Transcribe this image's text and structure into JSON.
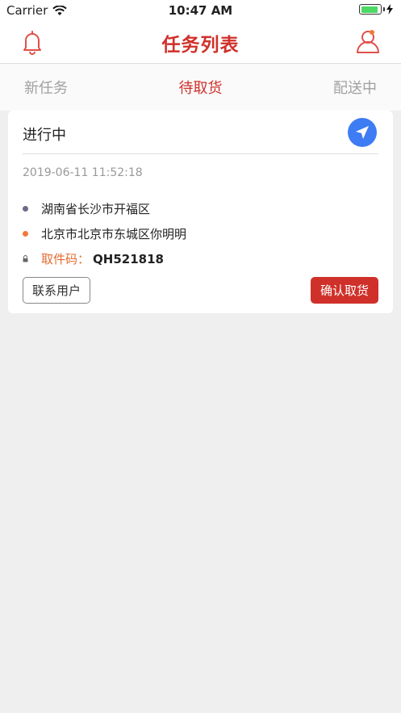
{
  "status_bar": {
    "carrier": "Carrier",
    "time": "10:47 AM",
    "battery_percent": 80
  },
  "header": {
    "title": "任务列表"
  },
  "tabs": [
    {
      "label": "新任务",
      "active": false
    },
    {
      "label": "待取货",
      "active": true
    },
    {
      "label": "配送中",
      "active": false
    }
  ],
  "task": {
    "status": "进行中",
    "time": "2019-06-11 11:52:18",
    "pickup_address": "湖南省长沙市开福区",
    "delivery_address": "北京市北京市东城区你明明",
    "code_label": "取件码：",
    "code_value": "QH521818",
    "contact_button": "联系用户",
    "confirm_button": "确认取货"
  },
  "colors": {
    "accent": "#d0302a",
    "nav_blue": "#3e7cf4",
    "dot_pickup": "#6b6b8a",
    "dot_delivery": "#f07a3a"
  }
}
